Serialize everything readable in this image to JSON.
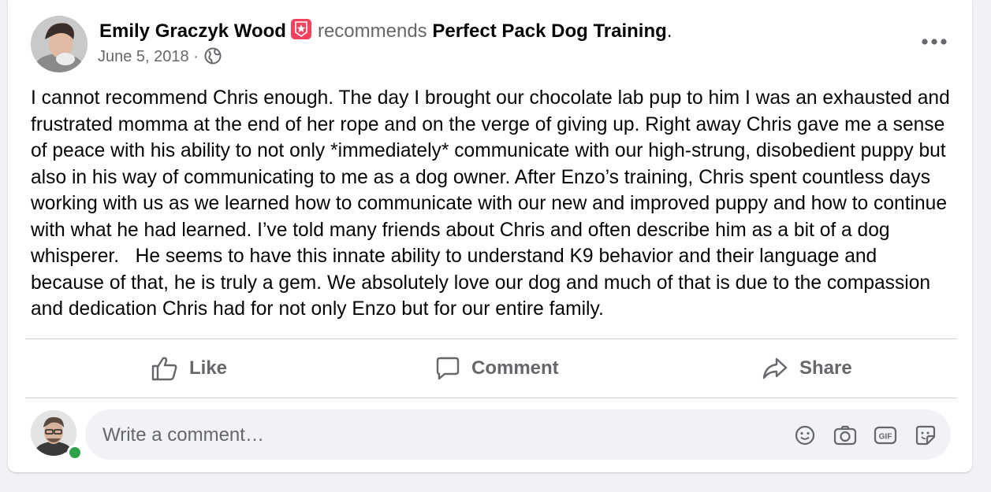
{
  "post": {
    "author": "Emily Graczyk Wood",
    "verb": "recommends",
    "page_name": "Perfect Pack Dog Training",
    "date": "June 5, 2018",
    "date_separator": " · ",
    "privacy_icon": "globe-icon",
    "more_icon": "more-horizontal-icon",
    "badge_icon": "recommendation-badge-icon",
    "badge_color": "#f3425f",
    "text": "I cannot recommend Chris enough. The day I brought our chocolate lab pup to him I was an exhausted and frustrated momma at the end of her rope and on the verge of giving up. Right away Chris gave me a sense of peace with his ability to not only *immediately* communicate with our high-strung, disobedient puppy but also in his way of communicating to me as a dog owner. After Enzo’s training, Chris spent countless days working with us as we learned how to communicate with our new and improved puppy and how to continue with what he had learned. I’ve told many friends about Chris and often describe him as a bit of a dog whisperer.   He seems to have this innate ability to understand K9 behavior and their language and because of that, he is truly a gem. We absolutely love our dog and much of that is due to the compassion and dedication Chris had for not only Enzo but for our entire family."
  },
  "actions": {
    "like": {
      "label": "Like",
      "icon": "thumbs-up-icon"
    },
    "comment": {
      "label": "Comment",
      "icon": "comment-bubble-icon"
    },
    "share": {
      "label": "Share",
      "icon": "share-arrow-icon"
    }
  },
  "comment_composer": {
    "placeholder": "Write a comment…",
    "online_status_color": "#31a24c",
    "icons": [
      "emoji-icon",
      "camera-icon",
      "gif-icon",
      "sticker-icon"
    ]
  },
  "colors": {
    "text_primary": "#050505",
    "text_secondary": "#65676b",
    "background": "#f0f2f5",
    "card": "#ffffff"
  }
}
